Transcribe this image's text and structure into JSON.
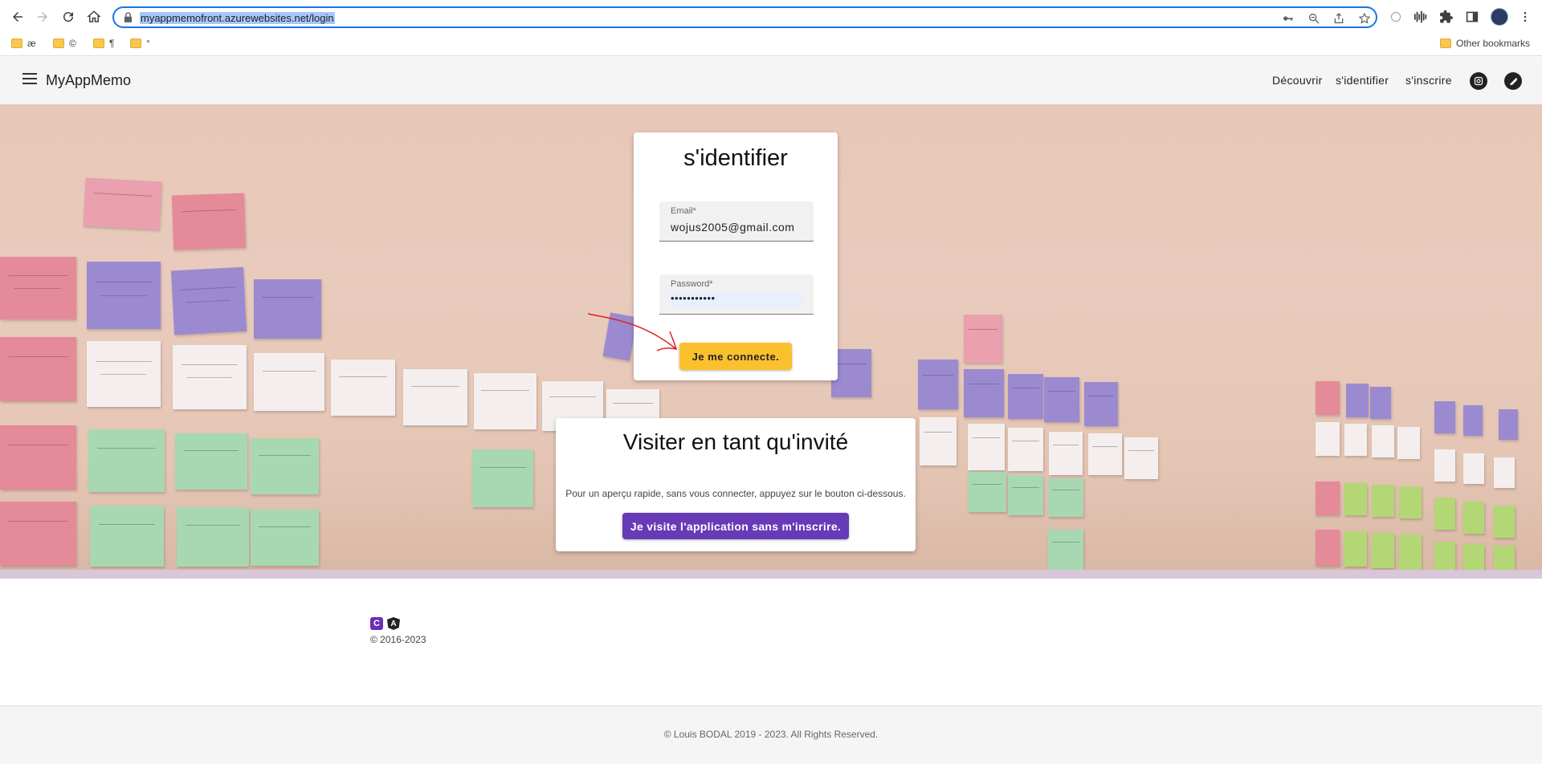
{
  "browser": {
    "url": "myappmemofront.azurewebsites.net/login",
    "bookmarks": [
      "æ",
      "©",
      "¶",
      "°"
    ],
    "other_bookmarks": "Other bookmarks",
    "icons": [
      "back-icon",
      "forward-icon",
      "reload-icon",
      "home-icon",
      "lock-icon",
      "key-icon",
      "zoom-icon",
      "share-icon",
      "star-icon",
      "extensions-icon",
      "sidepanel-icon",
      "menu-dots-icon"
    ]
  },
  "appbar": {
    "title": "MyAppMemo",
    "links": [
      "Découvrir",
      "s'identifier",
      "s'inscrire"
    ]
  },
  "login": {
    "title": "s'identifier",
    "email_label": "Email*",
    "email_value": "wojus2005@gmail.com",
    "password_label": "Password*",
    "password_value": "•••••••••••",
    "submit": "Je me connecte."
  },
  "guest": {
    "title": "Visiter en tant qu'invité",
    "text": "Pour un aperçu rapide, sans vous connecter, appuyez sur le bouton ci-dessous.",
    "button": "Je visite l'application sans m'inscrire."
  },
  "page_footer": {
    "logo_c": "C",
    "logo_a": "A",
    "years": "© 2016-2023",
    "copyright": "© Louis BODAL 2019 - 2023. All Rights Reserved."
  },
  "colors": {
    "accent_yellow": "#fbc02d",
    "accent_purple": "#673ab7",
    "omnibox_border": "#1a73e8"
  }
}
